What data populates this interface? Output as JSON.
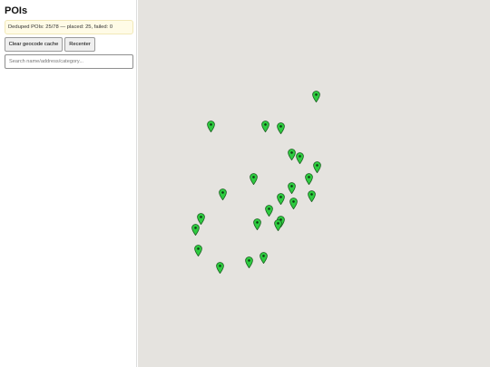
{
  "sidebar": {
    "title": "POIs",
    "status": "Deduped POIs: 25/78 — placed: 25, failed: 0",
    "buttons": {
      "clear_cache": "Clear geocode cache",
      "recenter": "Recenter"
    },
    "search": {
      "placeholder": "Search name/address/category...",
      "value": ""
    }
  },
  "map": {
    "background": "#e5e3df",
    "marker_color": "#2ecc40",
    "marker_icon": "map-pin-icon",
    "marker_count": 25
  }
}
